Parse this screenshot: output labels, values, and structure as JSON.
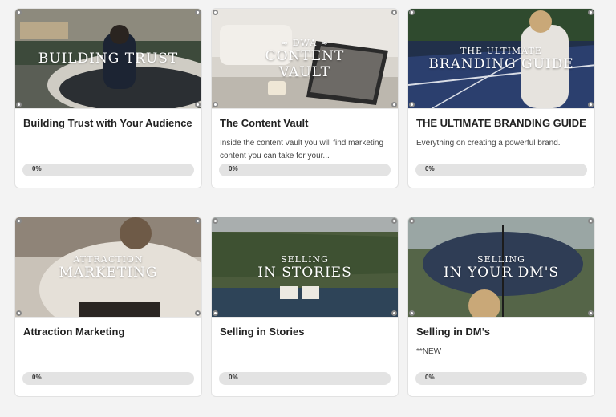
{
  "courses": [
    {
      "overlay": [
        "BUILDING TRUST"
      ],
      "overlay_small": "",
      "title": "Building Trust with Your Audience",
      "description": "",
      "progress_label": "0%",
      "progress": 0
    },
    {
      "overlay": [
        "CONTENT",
        "VAULT"
      ],
      "overlay_small": "≈ DWA ≈",
      "title": "The Content Vault",
      "description": "Inside the content vault you will find marketing content you can take for your...",
      "progress_label": "0%",
      "progress": 0
    },
    {
      "overlay": [
        "BRANDING GUIDE"
      ],
      "overlay_small": "THE ULTIMATE",
      "title": "THE ULTIMATE BRANDING GUIDE",
      "description": "Everything on creating a powerful brand.",
      "progress_label": "0%",
      "progress": 0
    },
    {
      "overlay": [
        "MARKETING"
      ],
      "overlay_small": "ATTRACTION",
      "title": "Attraction Marketing",
      "description": "",
      "progress_label": "0%",
      "progress": 0
    },
    {
      "overlay": [
        "IN STORIES"
      ],
      "overlay_small": "SELLING",
      "title": "Selling in Stories",
      "description": "",
      "progress_label": "0%",
      "progress": 0
    },
    {
      "overlay": [
        "IN YOUR DM'S"
      ],
      "overlay_small": "SELLING",
      "title": "Selling in DM’s",
      "description": "**NEW",
      "progress_label": "0%",
      "progress": 0
    }
  ]
}
